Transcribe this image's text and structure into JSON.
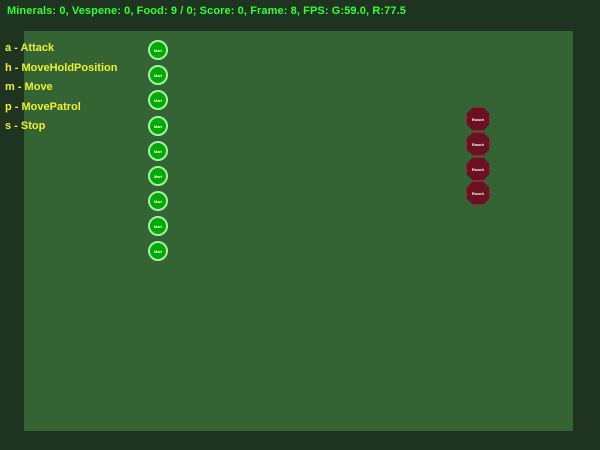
{
  "status_bar": {
    "text": "Minerals: 0, Vespene: 0, Food: 9 / 0; Score: 0, Frame: 8, FPS: G:59.0, R:77.5"
  },
  "colors": {
    "background": "#1e3320",
    "map": "#346434",
    "status_text": "#33ff33",
    "command_text": "#f0f033",
    "friendly_unit": "#00aa00",
    "enemy_unit": "#6b0f22"
  },
  "commands": [
    {
      "key": "a",
      "label": "a - Attack"
    },
    {
      "key": "h",
      "label": "h - MoveHoldPosition"
    },
    {
      "key": "m",
      "label": "m - Move"
    },
    {
      "key": "p",
      "label": "p - MovePatrol"
    },
    {
      "key": "s",
      "label": "s - Stop"
    }
  ],
  "friendly_units": [
    {
      "label": "Mari"
    },
    {
      "label": "Mari"
    },
    {
      "label": "Mari"
    },
    {
      "label": "Mari"
    },
    {
      "label": "Mari"
    },
    {
      "label": "Mari"
    },
    {
      "label": "Mari"
    },
    {
      "label": "Mari"
    },
    {
      "label": "Mari"
    }
  ],
  "enemy_units": [
    {
      "label": "Roach"
    },
    {
      "label": "Roach"
    },
    {
      "label": "Roach"
    },
    {
      "label": "Roach"
    }
  ]
}
